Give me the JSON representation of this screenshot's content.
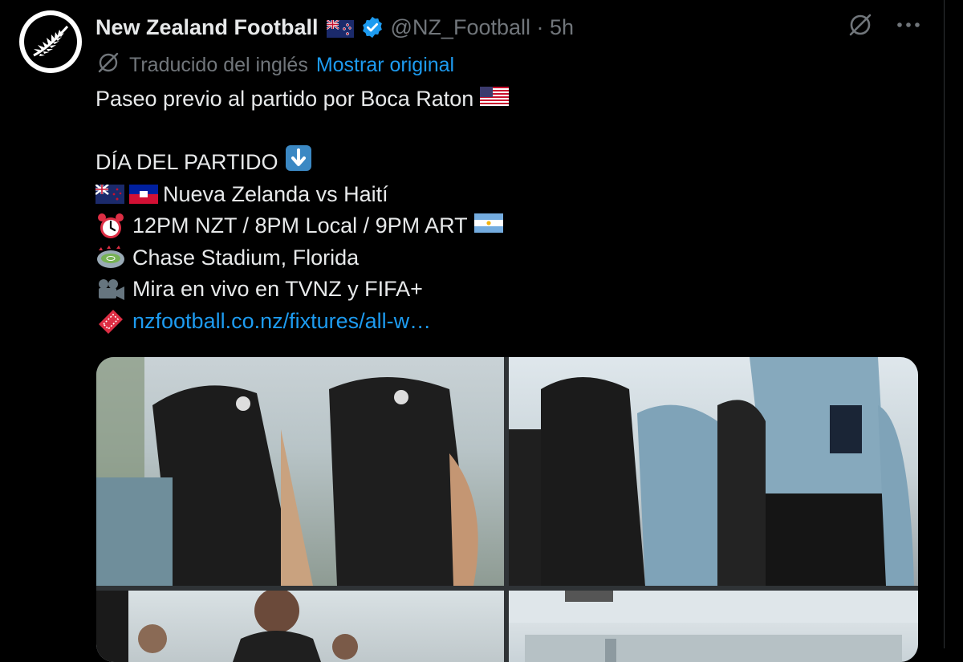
{
  "tweet": {
    "author_name": "New Zealand Football",
    "handle_time": "@NZ_Football · 5h",
    "translated_label": "Traducido del inglés",
    "show_original_label": "Mostrar original",
    "lines": [
      "Paseo previo al partido por Boca Raton",
      "DÍA DEL PARTIDO",
      "Nueva Zelanda vs Haití",
      "12PM NZT / 8PM Local / 9PM ART",
      "Chase Stadium, Florida",
      "Mira en vivo en TVNZ y FIFA+",
      "nzfootball.co.nz/fixtures/all-w…"
    ]
  },
  "icons": {
    "avatar": "fern-logo",
    "author_flag": "new-zealand-flag",
    "verified": "verified-badge-icon",
    "translate": "translate-icon",
    "more": "more-icon",
    "emoji": [
      "us-flag",
      "down-arrow-emoji",
      "nz-flag",
      "haiti-flag",
      "alarm-clock-emoji",
      "argentina-flag",
      "stadium-emoji",
      "movie-camera-emoji",
      "ticket-emoji"
    ]
  },
  "colors": {
    "background": "#000000",
    "text": "#e7e9ea",
    "muted": "#71767b",
    "link": "#1d9bf0",
    "verified": "#1d9bf0"
  },
  "media": {
    "count": 4,
    "description_tiles": [
      "team-walk-photo-1",
      "team-walk-photo-2",
      "team-walk-photo-3",
      "team-walk-photo-4"
    ]
  }
}
